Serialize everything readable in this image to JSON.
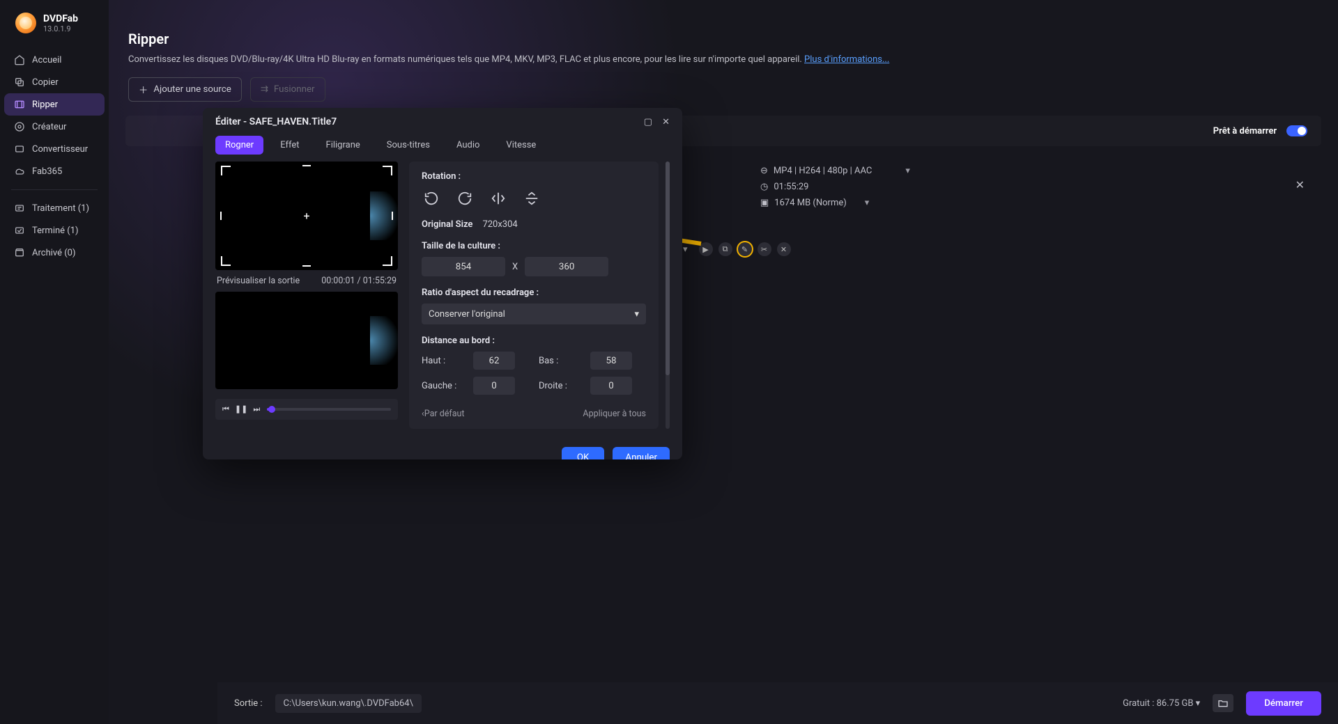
{
  "app": {
    "name": "DVDFab",
    "version": "13.0.1.9"
  },
  "sidebar": {
    "items": [
      {
        "label": "Accueil"
      },
      {
        "label": "Copier"
      },
      {
        "label": "Ripper"
      },
      {
        "label": "Créateur"
      },
      {
        "label": "Convertisseur"
      },
      {
        "label": "Fab365"
      }
    ],
    "lower": [
      {
        "label": "Traitement (1)"
      },
      {
        "label": "Terminé (1)"
      },
      {
        "label": "Archivé (0)"
      }
    ]
  },
  "page": {
    "title": "Ripper",
    "subtitle": "Convertissez les disques DVD/Blu-ray/4K Ultra HD Blu-ray en formats numériques tels que MP4, MKV, MP3, FLAC et plus encore, pour les lire sur n'importe quel appareil. ",
    "more_link": "Plus d'informations...",
    "add_source": "Ajouter une source",
    "merge": "Fusionner",
    "ready": "Prêt à démarrer"
  },
  "queue": {
    "format": "MP4 | H264 | 480p | AAC",
    "duration": "01:55:29",
    "size": "1674 MB (Norme)"
  },
  "modal": {
    "title": "Éditer - SAFE_HAVEN.Title7",
    "tabs": [
      "Rogner",
      "Effet",
      "Filigrane",
      "Sous-titres",
      "Audio",
      "Vitesse"
    ],
    "preview_label": "Prévisualiser la sortie",
    "timecode": "00:00:01 / 01:55:29",
    "rotation_label": "Rotation :",
    "orig_size_label": "Original Size",
    "orig_size_value": "720x304",
    "crop_size_label": "Taille de la culture :",
    "crop_w": "854",
    "crop_h": "360",
    "crop_x": "X",
    "ratio_label": "Ratio d'aspect du recadrage :",
    "ratio_value": "Conserver l'original",
    "edge_label": "Distance au bord :",
    "edge": {
      "haut_l": "Haut :",
      "haut_v": "62",
      "bas_l": "Bas :",
      "bas_v": "58",
      "gauche_l": "Gauche :",
      "gauche_v": "0",
      "droite_l": "Droite :",
      "droite_v": "0"
    },
    "default": "‹Par défaut",
    "apply_all": "Appliquer à tous",
    "ok": "OK",
    "cancel": "Annuler"
  },
  "footer": {
    "out_label": "Sortie :",
    "out_path": "C:\\Users\\kun.wang\\.DVDFab64\\",
    "free": "Gratuit : 86.75 GB ▾",
    "start": "Démarrer"
  }
}
